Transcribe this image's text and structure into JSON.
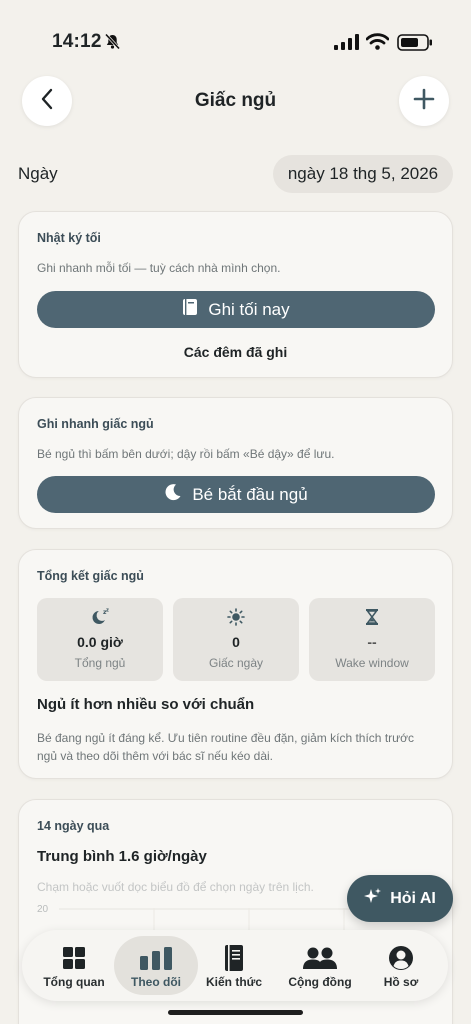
{
  "status": {
    "time": "14:12"
  },
  "header": {
    "title": "Giấc ngủ"
  },
  "date_row": {
    "label": "Ngày",
    "value": "ngày 18 thg 5, 2026"
  },
  "night_log": {
    "title": "Nhật ký tối",
    "description": "Ghi nhanh mỗi tối — tuỳ cách nhà mình chọn.",
    "button_label": "Ghi tối nay",
    "link_label": "Các đêm đã ghi"
  },
  "quick_log": {
    "title": "Ghi nhanh giấc ngủ",
    "description": "Bé ngủ thì bấm bên dưới; dậy rồi bấm «Bé dậy» để lưu.",
    "button_label": "Bé bắt đầu ngủ"
  },
  "summary": {
    "title": "Tổng kết giấc ngủ",
    "stats": [
      {
        "icon": "moon-zzz-icon",
        "value": "0.0 giờ",
        "label": "Tổng ngủ"
      },
      {
        "icon": "sun-icon",
        "value": "0",
        "label": "Giấc ngày"
      },
      {
        "icon": "hourglass-icon",
        "value": "--",
        "label": "Wake window"
      }
    ],
    "headline": "Ngủ ít hơn nhiều so với chuẩn",
    "advice": "Bé đang ngủ ít đáng kể. Ưu tiên routine đều đặn, giảm kích thích trước ngủ và theo dõi thêm với bác sĩ nếu kéo dài."
  },
  "history": {
    "title": "14 ngày qua",
    "average": "Trung bình 1.6 giờ/ngày",
    "hint": "Chạm hoặc vuốt dọc biểu đồ để chọn ngày trên lịch.",
    "y_max_label": "20"
  },
  "ai_button": {
    "label": "Hỏi AI"
  },
  "nav": {
    "items": [
      {
        "label": "Tổng quan",
        "icon": "grid-icon"
      },
      {
        "label": "Theo dõi",
        "icon": "bar-chart-icon",
        "active": true
      },
      {
        "label": "Kiến thức",
        "icon": "book-icon"
      },
      {
        "label": "Cộng đồng",
        "icon": "people-icon"
      },
      {
        "label": "Hồ sơ",
        "icon": "profile-icon"
      }
    ]
  },
  "colors": {
    "background": "#f3f1ec",
    "primary_button": "#4f6673",
    "ai_button": "#3f5862",
    "card_title": "#3c4d57"
  }
}
